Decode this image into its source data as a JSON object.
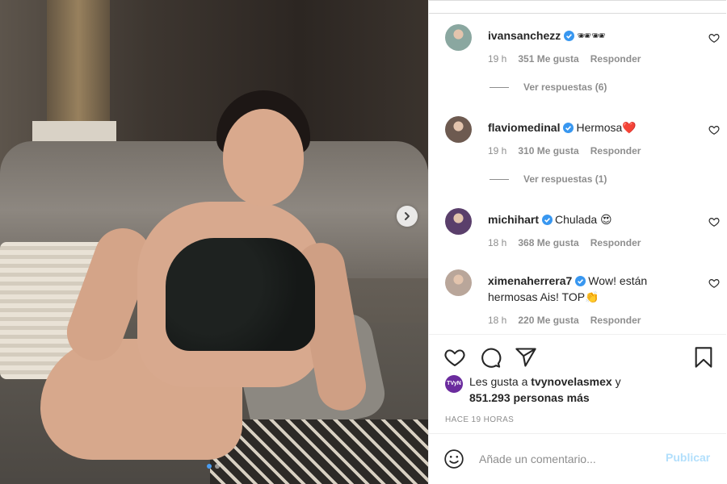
{
  "post": {
    "carousel": {
      "slide_count": 2,
      "active_index": 0
    }
  },
  "comments": [
    {
      "username": "ivansanchezz",
      "verified": true,
      "text": "🕶🕶",
      "time": "19 h",
      "likes": "351 Me gusta",
      "reply_label": "Responder",
      "view_replies": "Ver respuestas (6)",
      "avatar_color": "#8aa7a0"
    },
    {
      "username": "flaviomedinal",
      "verified": true,
      "text": "Hermosa❤️",
      "time": "19 h",
      "likes": "310 Me gusta",
      "reply_label": "Responder",
      "view_replies": "Ver respuestas (1)",
      "avatar_color": "#6d5a50"
    },
    {
      "username": "michihart",
      "verified": true,
      "text": "Chulada 😍",
      "time": "18 h",
      "likes": "368 Me gusta",
      "reply_label": "Responder",
      "avatar_color": "#5a3f6b"
    },
    {
      "username": "ximenaherrera7",
      "verified": true,
      "text": "Wow! están hermosas Ais! TOP👏",
      "time": "18 h",
      "likes": "220 Me gusta",
      "reply_label": "Responder",
      "avatar_color": "#b9a69a"
    }
  ],
  "actions": {
    "icons": [
      "heart-icon",
      "comment-icon",
      "share-icon",
      "bookmark-icon"
    ]
  },
  "likes_summary": {
    "prefix": "Les gusta a ",
    "user": "tvynovelasmex",
    "connector": " y",
    "others": "851.293 personas más",
    "avatar_text": "TVyN"
  },
  "timestamp": "HACE 19 HORAS",
  "composer": {
    "placeholder": "Añade un comentario...",
    "publish_label": "Publicar"
  },
  "colors": {
    "verified_blue": "#3897f0",
    "publish_disabled": "#b2dffc",
    "muted_text": "#8e8e8e"
  }
}
